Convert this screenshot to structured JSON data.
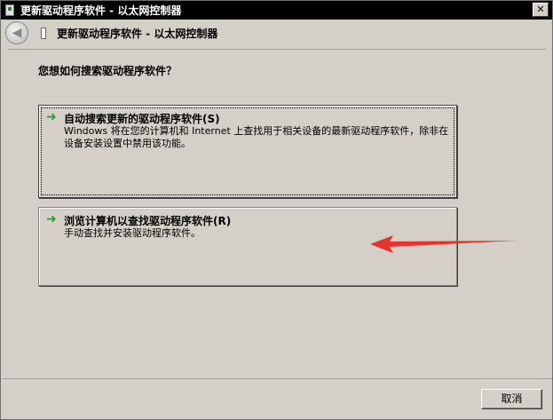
{
  "window": {
    "title": "更新驱动程序软件 - 以太网控制器",
    "close_label": "✕"
  },
  "nav": {
    "back_glyph": "◀",
    "title": "更新驱动程序软件 - 以太网控制器"
  },
  "main": {
    "question": "您想如何搜索驱动程序软件？",
    "options": [
      {
        "title": "自动搜索更新的驱动程序软件(S)",
        "description": "Windows 将在您的计算机和 Internet 上查找用于相关设备的最新驱动程序软件，除非在设备安装设置中禁用该功能。",
        "icon": "green-arrow-icon"
      },
      {
        "title": "浏览计算机以查找驱动程序软件(R)",
        "description": "手动查找并安装驱动程序软件。",
        "icon": "green-arrow-icon"
      }
    ]
  },
  "footer": {
    "cancel_label": "取消"
  },
  "colors": {
    "titlebar": "#000000",
    "background": "#d4d0c8",
    "option_arrow": "#2a9d2a",
    "annotation_arrow": "#e8322a"
  }
}
